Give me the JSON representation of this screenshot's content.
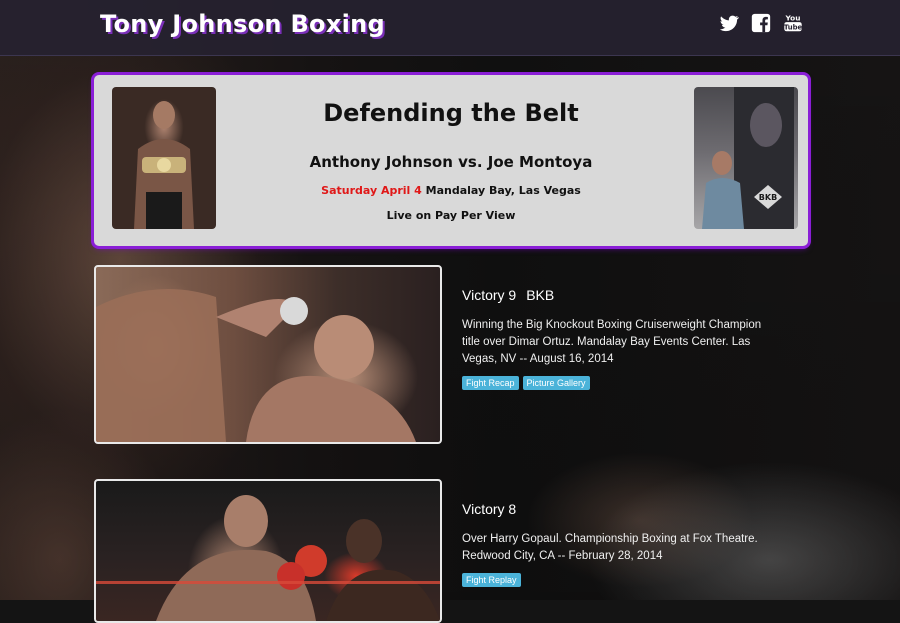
{
  "header": {
    "brand": "Tony Johnson Boxing",
    "social": [
      {
        "icon": "twitter-icon"
      },
      {
        "icon": "facebook-icon"
      },
      {
        "icon": "youtube-icon"
      }
    ]
  },
  "banner": {
    "title": "Defending the Belt",
    "matchup": "Anthony Johnson vs. Joe Montoya",
    "date": "Saturday April 4",
    "venue": "Mandalay Bay, Las Vegas",
    "broadcast": "Live on Pay Per View"
  },
  "fights": [
    {
      "title": "Victory 9",
      "tag": "BKB",
      "description": "Winning the Big Knockout Boxing Cruiserweight Champion title over Dimar Ortuz. Mandalay Bay Events Center. Las Vegas, NV -- August 16, 2014",
      "buttons": [
        "Fight Recap",
        "Picture Gallery"
      ]
    },
    {
      "title": "Victory 8",
      "tag": "",
      "description": "Over Harry Gopaul. Championship Boxing at Fox Theatre. Redwood City, CA -- February 28, 2014",
      "buttons": [
        "Fight Replay"
      ]
    }
  ],
  "colors": {
    "navbar": "#262230",
    "accent_purple": "#8a1ed6",
    "button_blue": "#4bb3d9",
    "date_red": "#e01818"
  }
}
